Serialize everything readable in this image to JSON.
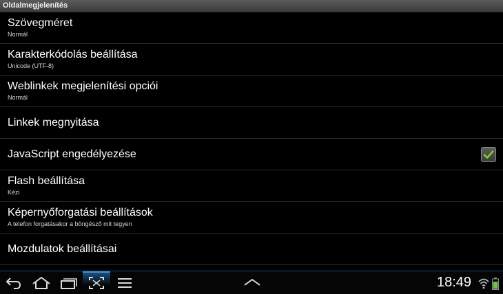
{
  "titlebar": {
    "title": "Oldalmegjelenítés"
  },
  "settings": {
    "items": [
      {
        "label": "Szövegméret",
        "summary": "Normál"
      },
      {
        "label": "Karakterkódolás beállítása",
        "summary": "Unicode (UTF-8)"
      },
      {
        "label": "Weblinkek megjelenítési opciói",
        "summary": "Normál"
      },
      {
        "label": "Linkek megnyitása"
      },
      {
        "label": "JavaScript engedélyezése",
        "checked": true
      },
      {
        "label": "Flash beállítása",
        "summary": "Kézi"
      },
      {
        "label": "Képernyőforgatási beállítások",
        "summary": "A telefon forgatásakor a böngésző mit tegyen"
      },
      {
        "label": "Mozdulatok beállításai"
      }
    ]
  },
  "navbar": {
    "buttons": [
      "back-icon",
      "home-icon",
      "recent-apps-icon",
      "screenshot-icon",
      "menu-icon",
      "expand-up-icon"
    ],
    "active": "screenshot-icon"
  },
  "status": {
    "time": "18:49",
    "icons": [
      "wifi-icon",
      "battery-icon"
    ]
  },
  "colors": {
    "background": "#000000",
    "accent": "#3a8fd6",
    "check": "#7ed321",
    "battery": "#6cc24a"
  }
}
